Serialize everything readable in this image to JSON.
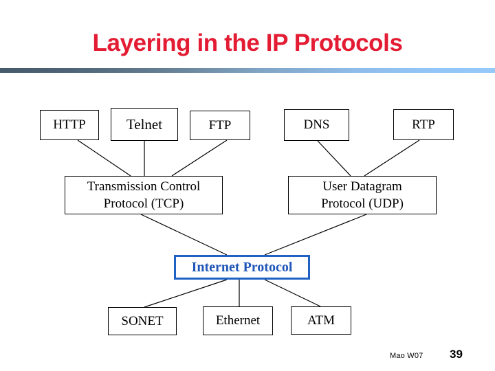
{
  "slide": {
    "title": "Layering in the IP Protocols",
    "title_color": "#E31B33",
    "background_color": "#FFFFFF",
    "rule_gradient_from": "#455A6B",
    "rule_gradient_to": "#96C9FA"
  },
  "diagram": {
    "layers": {
      "application": {
        "boxes": [
          {
            "id": "http",
            "label": "HTTP"
          },
          {
            "id": "telnet",
            "label": "Telnet"
          },
          {
            "id": "ftp",
            "label": "FTP"
          },
          {
            "id": "dns",
            "label": "DNS"
          },
          {
            "id": "rtp",
            "label": "RTP"
          }
        ]
      },
      "transport": {
        "boxes": [
          {
            "id": "tcp",
            "label": "Transmission Control\nProtocol (TCP)"
          },
          {
            "id": "udp",
            "label": "User Datagram\nProtocol (UDP)"
          }
        ]
      },
      "internet": {
        "boxes": [
          {
            "id": "ip",
            "label": "Internet Protocol",
            "text_color": "#1F56B8",
            "border_color": "#1F62C4"
          }
        ]
      },
      "link": {
        "boxes": [
          {
            "id": "sonet",
            "label": "SONET"
          },
          {
            "id": "ethernet",
            "label": "Ethernet"
          },
          {
            "id": "atm",
            "label": "ATM"
          }
        ]
      }
    },
    "connections": [
      {
        "from": "http",
        "to": "tcp"
      },
      {
        "from": "telnet",
        "to": "tcp"
      },
      {
        "from": "ftp",
        "to": "tcp"
      },
      {
        "from": "dns",
        "to": "udp"
      },
      {
        "from": "rtp",
        "to": "udp"
      },
      {
        "from": "tcp",
        "to": "ip"
      },
      {
        "from": "udp",
        "to": "ip"
      },
      {
        "from": "ip",
        "to": "sonet"
      },
      {
        "from": "ip",
        "to": "ethernet"
      },
      {
        "from": "ip",
        "to": "atm"
      }
    ]
  },
  "footer": {
    "author": "Mao W07",
    "page_number": "39"
  }
}
